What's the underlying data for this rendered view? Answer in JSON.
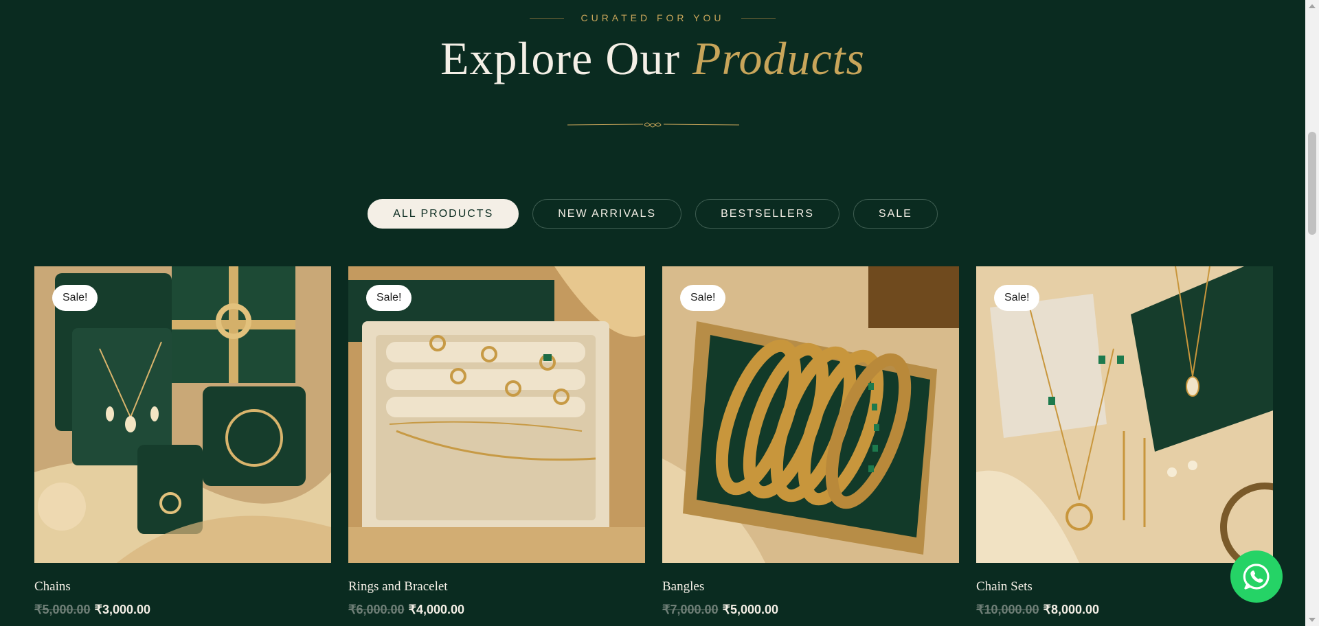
{
  "header": {
    "eyebrow": "CURATED FOR YOU",
    "title_main": "Explore Our",
    "title_accent": "Products"
  },
  "tabs": [
    {
      "label": "ALL PRODUCTS",
      "active": true
    },
    {
      "label": "NEW ARRIVALS",
      "active": false
    },
    {
      "label": "BESTSELLERS",
      "active": false
    },
    {
      "label": "SALE",
      "active": false
    }
  ],
  "products": [
    {
      "badge": "Sale!",
      "name": "Chains",
      "old_price": "₹5,000.00",
      "price": "₹3,000.00",
      "image_icon": "gift-box-jewelry-image"
    },
    {
      "badge": "Sale!",
      "name": "Rings and Bracelet",
      "old_price": "₹6,000.00",
      "price": "₹4,000.00",
      "image_icon": "ring-tray-image"
    },
    {
      "badge": "Sale!",
      "name": "Bangles",
      "old_price": "₹7,000.00",
      "price": "₹5,000.00",
      "image_icon": "bangles-image"
    },
    {
      "badge": "Sale!",
      "name": "Chain Sets",
      "old_price": "₹10,000.00",
      "price": "₹8,000.00",
      "image_icon": "pendant-set-image"
    }
  ],
  "colors": {
    "background": "#0a2b20",
    "gold": "#c8a55a",
    "cream": "#f4efe6",
    "whatsapp": "#25d366"
  },
  "floating": {
    "icon": "whatsapp-icon"
  }
}
